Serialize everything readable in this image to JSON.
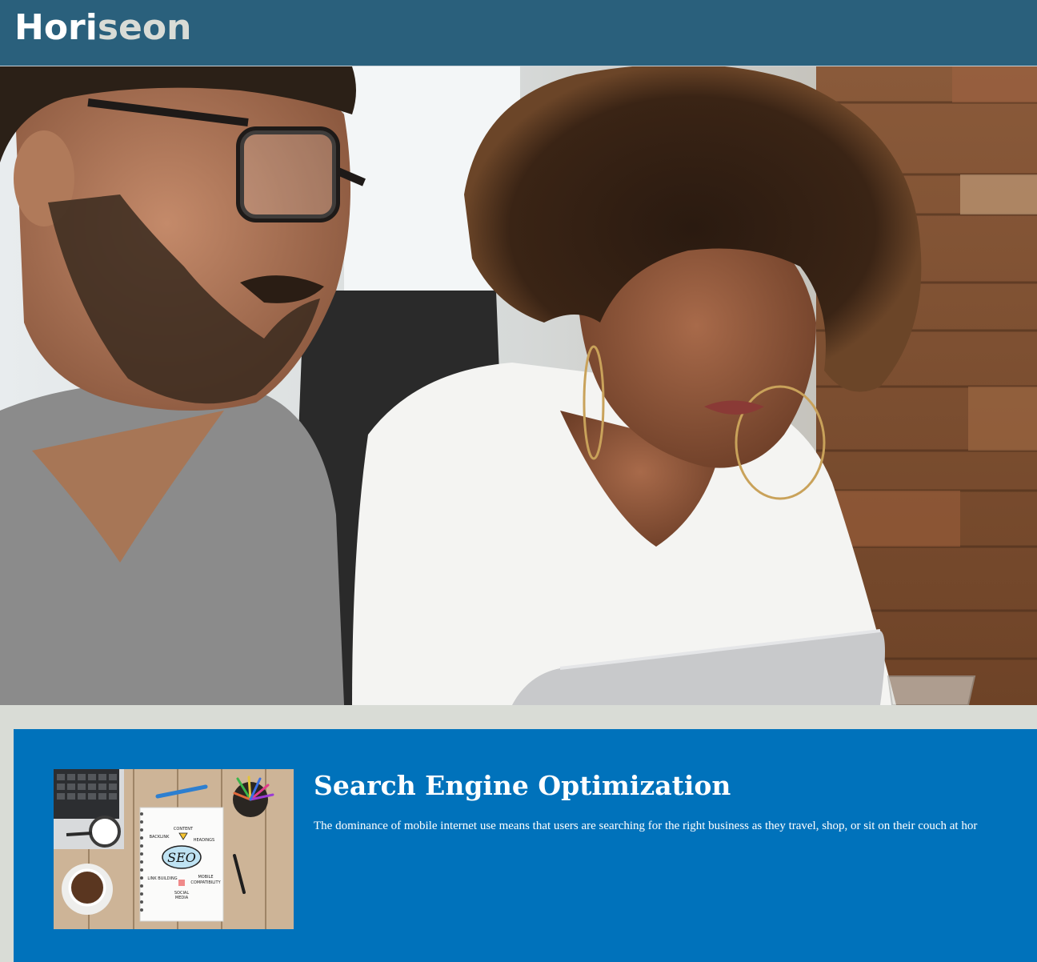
{
  "header": {
    "logo_prefix": "Hori",
    "logo_highlight": "seon"
  },
  "hero": {
    "image": "hero-photo-two-people-looking-at-laptop"
  },
  "content": {
    "seo": {
      "image": "seo-notebook-on-desk",
      "title": "Search Engine Optimization",
      "text": "The dominance of mobile internet use means that users are searching for the right business as they travel, shop, or sit on their couch at hor",
      "image_labels": {
        "content": "CONTENT",
        "backlink": "BACKLINK",
        "headings": "HEADINGS",
        "seo": "SEO",
        "link_building": "LINK BUILDING",
        "mobile": "MOBILE",
        "compatibility": "COMPATIBILITY",
        "social": "SOCIAL",
        "media": "MEDIA"
      }
    }
  },
  "colors": {
    "header_bg": "#2a607c",
    "page_bg": "#d9dcd6",
    "section_bg": "#0072bb",
    "logo_highlight": "#d9dcd6"
  }
}
